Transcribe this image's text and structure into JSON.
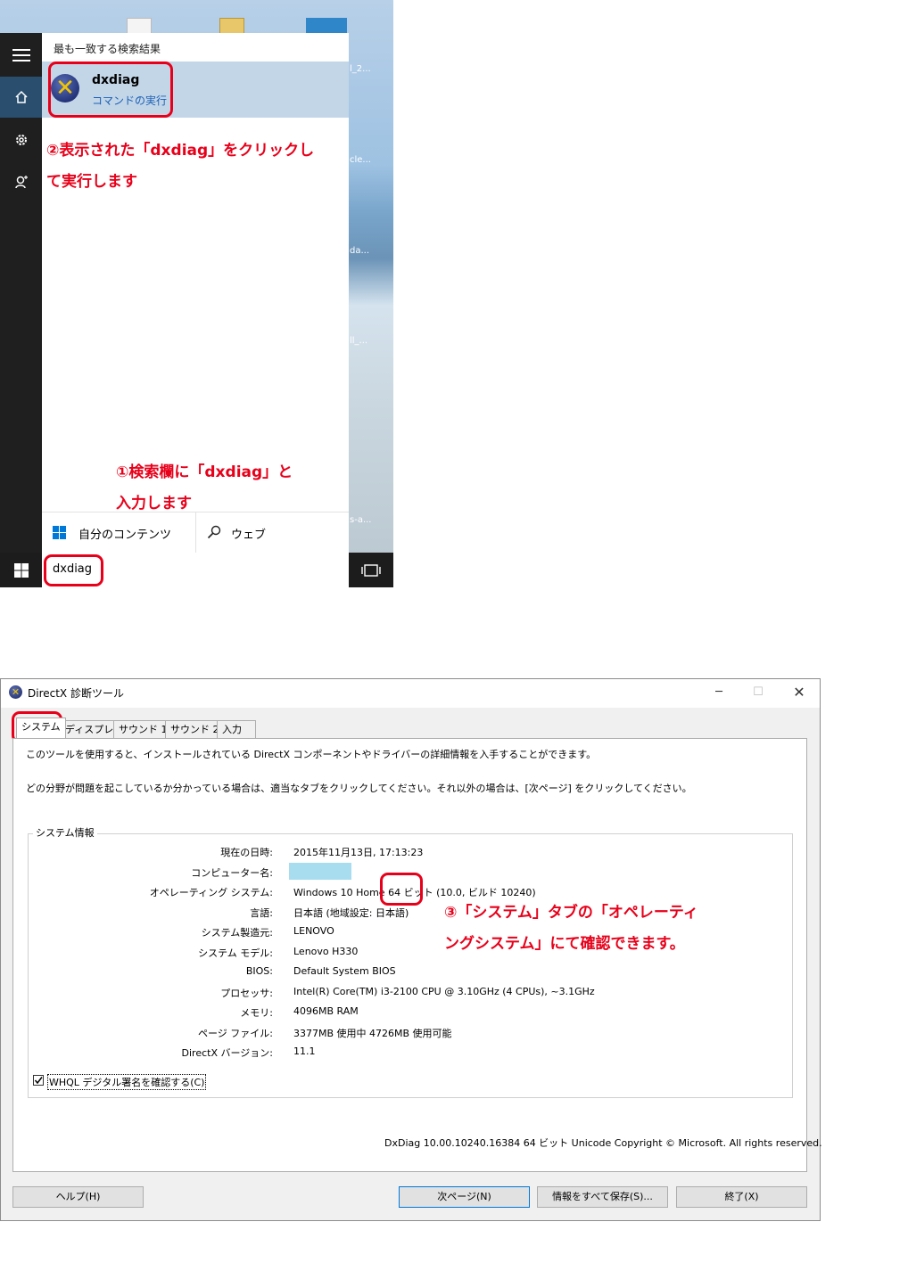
{
  "start_menu": {
    "best_match_heading": "最も一致する検索結果",
    "result": {
      "title": "dxdiag",
      "subtitle": "コマンドの実行"
    },
    "annotation_step2_line1": "②表示された「dxdiag」をクリックし",
    "annotation_step2_line2": "て実行します",
    "annotation_step1_line1": "①検索欄に「dxdiag」と",
    "annotation_step1_line2": "入力します",
    "filter_mine": "自分のコンテンツ",
    "filter_web": "ウェブ",
    "search_value": "dxdiag",
    "desktop_fragments": [
      "l_2...",
      "cle...",
      "da...",
      "ll_...",
      "s-a..."
    ]
  },
  "directx": {
    "window_title": "DirectX 診断ツール",
    "tabs": [
      "システム",
      "ディスプレイ",
      "サウンド 1",
      "サウンド 2",
      "入力"
    ],
    "intro_line1": "このツールを使用すると、インストールされている DirectX コンポーネントやドライバーの詳細情報を入手することができます。",
    "intro_line2": "どの分野が問題を起こしているか分かっている場合は、適当なタブをクリックしてください。それ以外の場合は、[次ページ] をクリックしてください。",
    "group_title": "システム情報",
    "rows": [
      {
        "label": "現在の日時:",
        "value": "2015年11月13日, 17:13:23"
      },
      {
        "label": "コンピューター名:",
        "value": ""
      },
      {
        "label": "オペレーティング システム:",
        "value": "Windows 10 Home 64 ビット (10.0, ビルド 10240)"
      },
      {
        "label": "言語:",
        "value": "日本語 (地域設定: 日本語)"
      },
      {
        "label": "システム製造元:",
        "value": "LENOVO"
      },
      {
        "label": "システム モデル:",
        "value": "Lenovo H330"
      },
      {
        "label": "BIOS:",
        "value": "Default System BIOS"
      },
      {
        "label": "プロセッサ:",
        "value": "Intel(R) Core(TM) i3-2100 CPU @ 3.10GHz (4 CPUs), ~3.1GHz"
      },
      {
        "label": "メモリ:",
        "value": "4096MB RAM"
      },
      {
        "label": "ページ ファイル:",
        "value": "3377MB 使用中 4726MB 使用可能"
      },
      {
        "label": "DirectX バージョン:",
        "value": "11.1"
      }
    ],
    "annotation_step3_line1": "③「システム」タブの「オペレーティ",
    "annotation_step3_line2": "ングシステム」にて確認できます。",
    "whql_label": "WHQL デジタル署名を確認する(C)",
    "whql_checked": true,
    "version_line": "DxDiag 10.00.10240.16384 64 ビット Unicode  Copyright © Microsoft. All rights reserved.",
    "buttons": {
      "help": "ヘルプ(H)",
      "next": "次ページ(N)",
      "save_all": "情報をすべて保存(S)...",
      "exit": "終了(X)"
    },
    "redacted_color": "#a8dcef"
  },
  "colors": {
    "annotation_red": "#e8001a",
    "selection_blue": "#c3d6e8",
    "link_blue": "#1a5fb4"
  }
}
